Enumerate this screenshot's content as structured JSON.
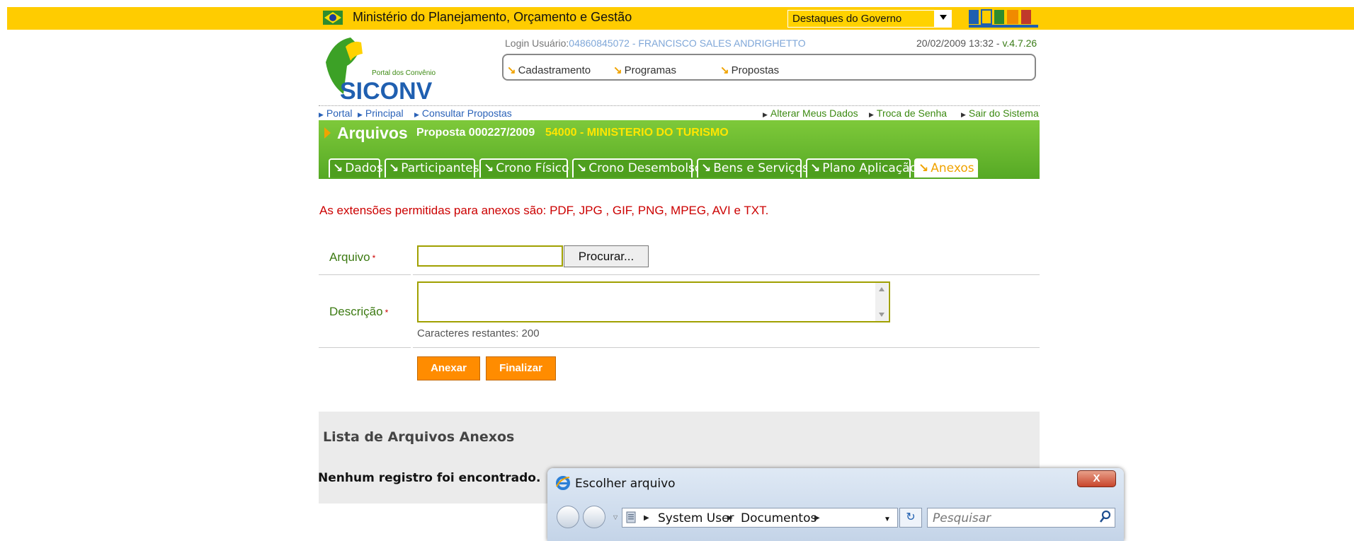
{
  "header": {
    "ministry": "Ministério do Planejamento, Orçamento e Gestão",
    "gov_select": "Destaques do Governo",
    "login_label": "Login Usuário:",
    "login_user": "04860845072 - FRANCISCO SALES ANDRIGHETTO",
    "datetime": "20/02/2009 13:32 - ",
    "version": "v.4.7.26",
    "logo_small": "Portal dos Convênios",
    "logo_big": "SICONV"
  },
  "menu": [
    {
      "label": "Cadastramento"
    },
    {
      "label": "Programas"
    },
    {
      "label": "Propostas"
    }
  ],
  "breadcrumb": [
    "Portal",
    "Principal",
    "Consultar Propostas"
  ],
  "user_links": [
    "Alterar Meus Dados",
    "Troca de Senha",
    "Sair do Sistema"
  ],
  "page": {
    "title": "Arquivos",
    "proposal": "Proposta 000227/2009",
    "org": "54000 - MINISTERIO DO TURISMO"
  },
  "tabs": [
    "Dados",
    "Participantes",
    "Crono Físico",
    "Crono Desembolso",
    "Bens e Serviços",
    "Plano Aplicação",
    "Anexos"
  ],
  "form": {
    "extensions_msg": "As extensões permitidas para anexos são: PDF, JPG , GIF, PNG, MPEG, AVI e TXT.",
    "file_label": "Arquivo",
    "browse_label": "Procurar...",
    "desc_label": "Descrição",
    "required_mark": "*",
    "chars_left": "Caracteres restantes: 200",
    "attach_label": "Anexar",
    "finish_label": "Finalizar"
  },
  "list": {
    "title": "Lista de Arquivos Anexos",
    "empty": "Nenhum registro foi encontrado."
  },
  "dialog": {
    "title": "Escolher arquivo",
    "close": "X",
    "path": [
      "System User",
      "Documentos"
    ],
    "search_placeholder": "Pesquisar"
  },
  "colors": {
    "top_bar": "#ffcc00",
    "green": "#5fb12b",
    "orange": "#ff8c00",
    "error_red": "#cc0000"
  }
}
